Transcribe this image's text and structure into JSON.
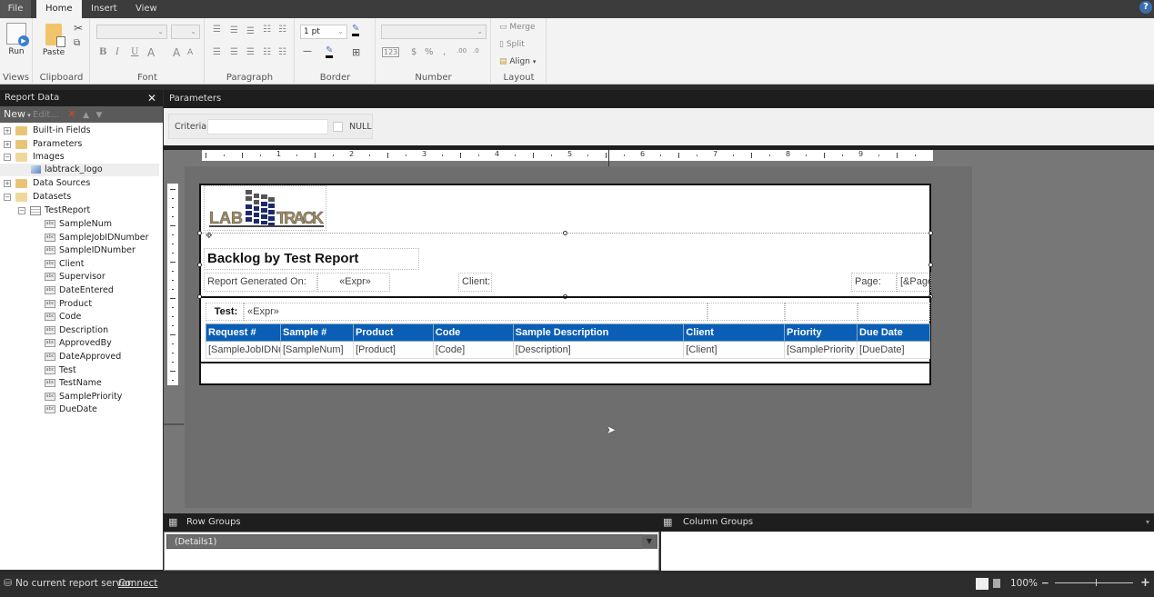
{
  "ribbon": {
    "tabs": [
      "File",
      "Home",
      "Insert",
      "View"
    ],
    "active_tab": "Home",
    "groups": {
      "views": {
        "label": "Views",
        "run_label": "Run"
      },
      "clipboard": {
        "label": "Clipboard",
        "paste_label": "Paste"
      },
      "font": {
        "label": "Font",
        "font_name": "",
        "font_size": ""
      },
      "paragraph": {
        "label": "Paragraph"
      },
      "border": {
        "label": "Border",
        "width_value": "1 pt"
      },
      "number": {
        "label": "Number",
        "format_value": ""
      },
      "layout": {
        "label": "Layout",
        "merge_label": "Merge",
        "split_label": "Split",
        "align_label": "Align"
      }
    }
  },
  "report_data": {
    "title": "Report Data",
    "toolbar": {
      "new_label": "New",
      "edit_label": "Edit..."
    },
    "tree": [
      {
        "label": "Built-in Fields",
        "type": "folder",
        "expanded": false
      },
      {
        "label": "Parameters",
        "type": "folder",
        "expanded": false
      },
      {
        "label": "Images",
        "type": "folder",
        "expanded": true
      },
      {
        "label": "labtrack_logo",
        "type": "image"
      },
      {
        "label": "Data Sources",
        "type": "folder",
        "expanded": false
      },
      {
        "label": "Datasets",
        "type": "folder",
        "expanded": true
      },
      {
        "label": "TestReport",
        "type": "dataset",
        "expanded": true
      }
    ],
    "fields": [
      "SampleNum",
      "SampleJobIDNumber",
      "SampleIDNumber",
      "Client",
      "Supervisor",
      "DateEntered",
      "Product",
      "Code",
      "Description",
      "ApprovedBy",
      "DateApproved",
      "Test",
      "TestName",
      "SamplePriority",
      "DueDate"
    ]
  },
  "parameters": {
    "title": "Parameters",
    "criteria_label": "Criteria",
    "criteria_value": "",
    "null_label": "NULL",
    "null_checked": false
  },
  "ruler": {
    "marks": [
      "1",
      "2",
      "3",
      "4",
      "5",
      "6",
      "7",
      "8",
      "9"
    ]
  },
  "report": {
    "logo_left": "LAB",
    "logo_right": "TRACK",
    "title": "Backlog by Test Report",
    "generated_label": "Report Generated On:",
    "generated_expr": "«Expr»",
    "client_label": "Client:",
    "page_label": "Page:",
    "page_expr": "[&Page",
    "test_label": "Test:",
    "test_expr": "«Expr»",
    "columns": [
      "Request #",
      "Sample #",
      "Product",
      "Code",
      "Sample Description",
      "Client",
      "Priority",
      "Due Date"
    ],
    "row": [
      "[SampleJobIDNu",
      "[SampleNum]",
      "[Product]",
      "[Code]",
      "[Description]",
      "[Client]",
      "[SamplePriority",
      "[DueDate]"
    ],
    "header_color": "#0a5eb5"
  },
  "groups": {
    "row_groups_label": "Row Groups",
    "column_groups_label": "Column Groups",
    "row_group_items": [
      "(Details1)"
    ]
  },
  "status": {
    "server_text": "No current report server.",
    "connect_label": "Connect",
    "zoom": "100%"
  }
}
